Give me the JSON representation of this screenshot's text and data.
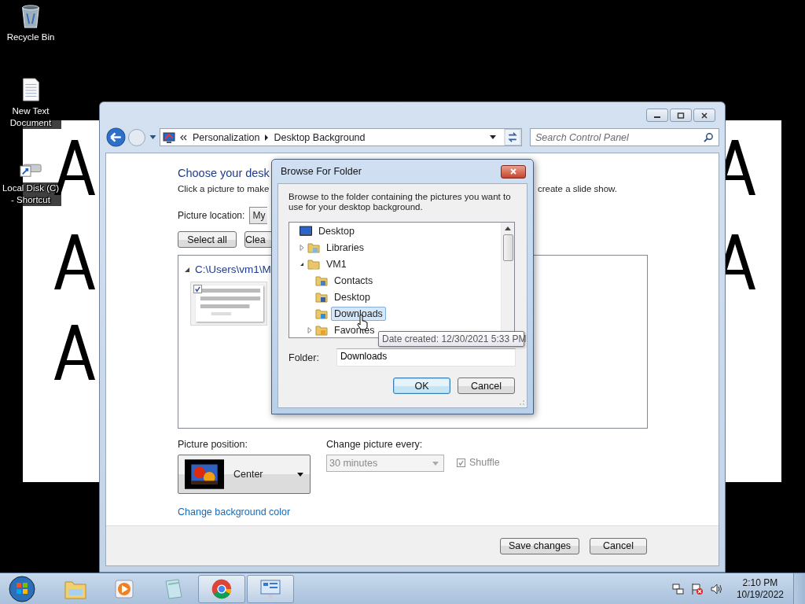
{
  "desktop": {
    "icons": [
      {
        "label": "Recycle Bin",
        "kind": "recycle"
      },
      {
        "label": "New Text Document",
        "kind": "text"
      },
      {
        "label": "Local Disk (C) - Shortcut",
        "kind": "drive"
      }
    ]
  },
  "window": {
    "address": {
      "crumbs": [
        "Personalization",
        "Desktop Background"
      ]
    },
    "search": {
      "placeholder": "Search Control Panel"
    },
    "heading": "Choose your desk",
    "intro": [
      "Click a picture to make",
      "create a slide show."
    ],
    "location": {
      "label": "Picture location:",
      "value": "My"
    },
    "list_buttons": [
      "Select all",
      "Clea"
    ],
    "group": {
      "path": "C:\\Users\\vm1\\M",
      "expanded": true,
      "pictures": [
        {
          "checked": true
        }
      ]
    },
    "position": {
      "label": "Picture position:",
      "value": "Center"
    },
    "interval": {
      "label": "Change picture every:",
      "value": "30 minutes",
      "disabled": true
    },
    "shuffle": {
      "label": "Shuffle",
      "checked": true,
      "disabled": true
    },
    "link": "Change background color",
    "footer_buttons": [
      "Save changes",
      "Cancel"
    ]
  },
  "dialog": {
    "title": "Browse For Folder",
    "description": "Browse to the folder containing the pictures you want to use for your desktop background.",
    "tree": [
      {
        "label": "Desktop",
        "kind": "desktop",
        "selected": false,
        "children": [
          {
            "label": "Libraries",
            "kind": "libraries",
            "selected": false,
            "expanded": false
          },
          {
            "label": "VM1",
            "kind": "user",
            "selected": false,
            "expanded": true,
            "children": [
              {
                "label": "Contacts",
                "kind": "contacts",
                "selected": false
              },
              {
                "label": "Desktop",
                "kind": "desktop-folder",
                "selected": false
              },
              {
                "label": "Downloads",
                "kind": "downloads",
                "selected": true
              },
              {
                "label": "Favorites",
                "kind": "favorites",
                "selected": false,
                "expanded": false
              }
            ]
          }
        ]
      }
    ],
    "folder": {
      "label": "Folder:",
      "value": "Downloads"
    },
    "buttons": [
      {
        "label": "OK",
        "default": true
      },
      {
        "label": "Cancel",
        "default": false
      }
    ],
    "tooltip": "Date created: 12/30/2021 5:33 PM"
  },
  "taskbar": {
    "apps": [
      {
        "kind": "explorer",
        "highlighted": false
      },
      {
        "kind": "media",
        "highlighted": false
      },
      {
        "kind": "notes",
        "highlighted": false
      },
      {
        "kind": "chrome",
        "highlighted": true
      },
      {
        "kind": "control",
        "highlighted": true
      }
    ],
    "time": "2:10 PM",
    "date": "10/19/2022"
  }
}
